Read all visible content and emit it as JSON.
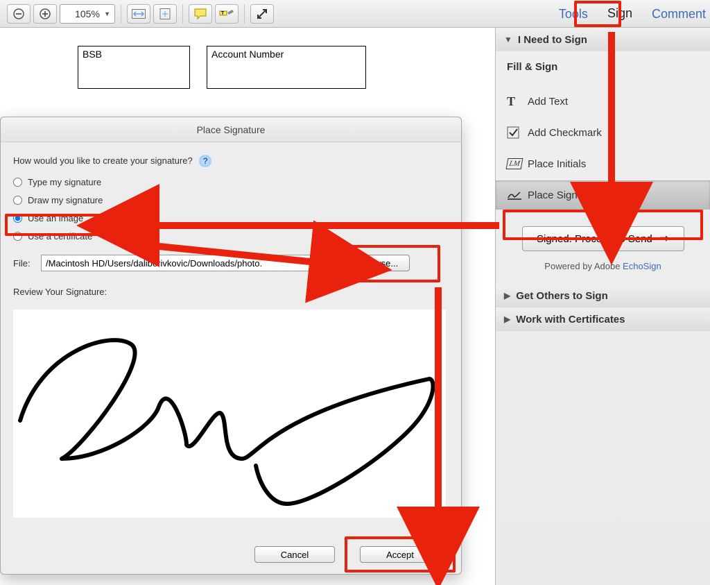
{
  "toolbar": {
    "zoom": "105%",
    "tab_tools": "Tools",
    "tab_sign": "Sign",
    "tab_comment": "Comment"
  },
  "doc": {
    "field_bsb": "BSB",
    "field_account": "Account Number"
  },
  "dialog": {
    "title": "Place Signature",
    "prompt": "How would you like to create your signature?",
    "opt_type": "Type my signature",
    "opt_draw": "Draw my signature",
    "opt_image": "Use an image",
    "opt_cert": "Use a certificate",
    "file_label": "File:",
    "file_path": "/Macintosh HD/Users/daliborivkovic/Downloads/photo.",
    "browse": "Browse...",
    "review": "Review Your Signature:",
    "cancel": "Cancel",
    "accept": "Accept"
  },
  "panel": {
    "section_i_need": "I Need to Sign",
    "fill_sign": "Fill & Sign",
    "add_text": "Add Text",
    "add_check": "Add Checkmark",
    "place_initials": "Place Initials",
    "place_signature": "Place Signature",
    "proceed": "Signed. Proceed to Send",
    "powered_prefix": "Powered by Adobe ",
    "powered_link": "EchoSign",
    "section_others": "Get Others to Sign",
    "section_certs": "Work with Certificates"
  }
}
